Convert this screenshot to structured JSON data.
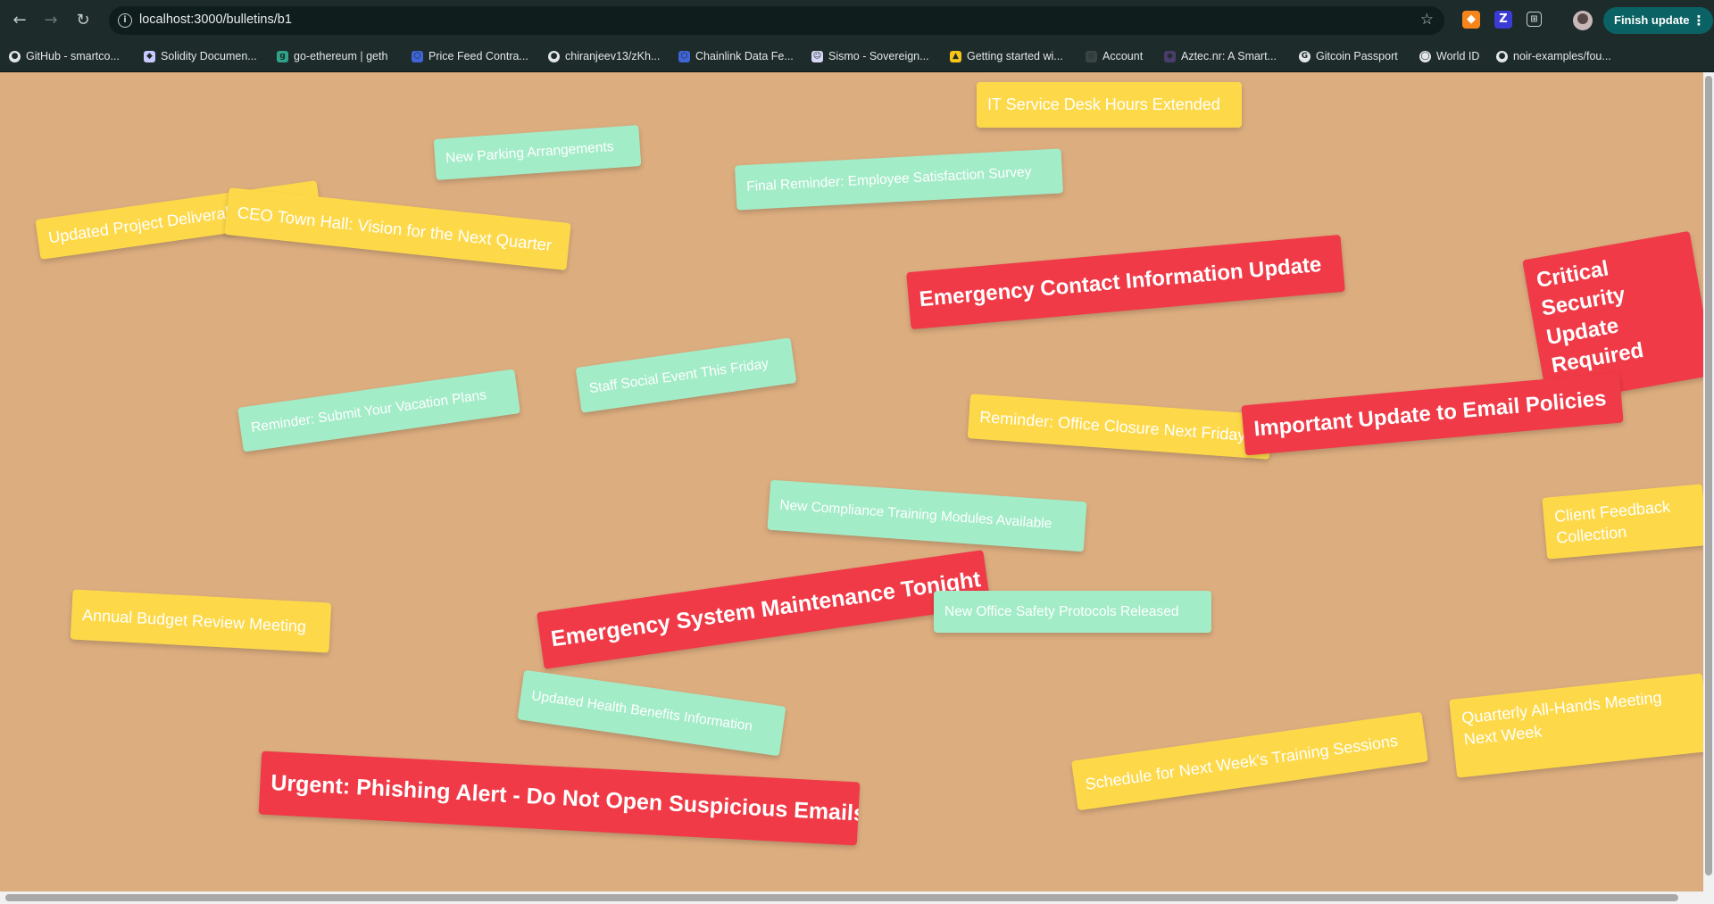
{
  "browser": {
    "url": "localhost:3000/bulletins/b1",
    "finish_update_label": "Finish update",
    "bookmarks": [
      {
        "label": "GitHub - smartco...",
        "icon": "github-icon"
      },
      {
        "label": "Solidity Documen...",
        "icon": "solidity-icon"
      },
      {
        "label": "go-ethereum | geth",
        "icon": "geth-icon"
      },
      {
        "label": "Price Feed Contra...",
        "icon": "chainlink-icon"
      },
      {
        "label": "chiranjeev13/zKh...",
        "icon": "github-icon"
      },
      {
        "label": "Chainlink Data Fe...",
        "icon": "chainlink-icon"
      },
      {
        "label": "Sismo - Sovereign...",
        "icon": "sismo-icon"
      },
      {
        "label": "Getting started wi...",
        "icon": "warning-icon"
      },
      {
        "label": "Account",
        "icon": "account-icon"
      },
      {
        "label": "Aztec.nr: A Smart...",
        "icon": "aztec-icon"
      },
      {
        "label": "Gitcoin Passport",
        "icon": "gitcoin-icon"
      },
      {
        "label": "World ID",
        "icon": "worldid-icon"
      },
      {
        "label": "noir-examples/fou...",
        "icon": "github-icon"
      }
    ]
  },
  "colors": {
    "board": "#dcad7f",
    "yellow": "#fdd94a",
    "green": "#a3ecc8",
    "red": "#f03a47"
  },
  "bulletins": [
    {
      "id": "it-service-desk",
      "title": "IT Service Desk Hours Extended",
      "color": "yellow"
    },
    {
      "id": "new-parking",
      "title": "New Parking Arrangements",
      "color": "green"
    },
    {
      "id": "final-reminder-survey",
      "title": "Final Reminder: Employee Satisfaction Survey",
      "color": "green"
    },
    {
      "id": "updated-project-deliverables",
      "title": "Updated Project Deliverables",
      "color": "yellow"
    },
    {
      "id": "ceo-town-hall",
      "title": "CEO Town Hall: Vision for the Next Quarter",
      "color": "yellow"
    },
    {
      "id": "emergency-contact-info",
      "title": "Emergency Contact Information Update",
      "color": "red"
    },
    {
      "id": "critical-security-update",
      "title": "Critical Security Update Required",
      "color": "red"
    },
    {
      "id": "staff-social-event",
      "title": "Staff Social Event This Friday",
      "color": "green"
    },
    {
      "id": "vacation-plans-reminder",
      "title": "Reminder: Submit Your Vacation Plans",
      "color": "green"
    },
    {
      "id": "office-closure-reminder",
      "title": "Reminder: Office Closure Next Friday",
      "color": "yellow"
    },
    {
      "id": "email-policies-update",
      "title": "Important Update to Email Policies",
      "color": "red"
    },
    {
      "id": "compliance-training",
      "title": "New Compliance Training Modules Available",
      "color": "green"
    },
    {
      "id": "client-feedback",
      "title": "Client Feedback Collection",
      "color": "yellow"
    },
    {
      "id": "annual-budget-review",
      "title": "Annual Budget Review Meeting",
      "color": "yellow"
    },
    {
      "id": "emergency-maintenance",
      "title": "Emergency System Maintenance Tonight",
      "color": "red"
    },
    {
      "id": "office-safety-protocols",
      "title": "New Office Safety Protocols Released",
      "color": "green"
    },
    {
      "id": "health-benefits",
      "title": "Updated Health Benefits Information",
      "color": "green"
    },
    {
      "id": "phishing-alert",
      "title": "Urgent: Phishing Alert - Do Not Open Suspicious Emails",
      "color": "red"
    },
    {
      "id": "training-sessions-schedule",
      "title": "Schedule for Next Week's Training Sessions",
      "color": "yellow"
    },
    {
      "id": "quarterly-all-hands",
      "title": "Quarterly All-Hands Meeting Next Week",
      "color": "yellow"
    }
  ]
}
